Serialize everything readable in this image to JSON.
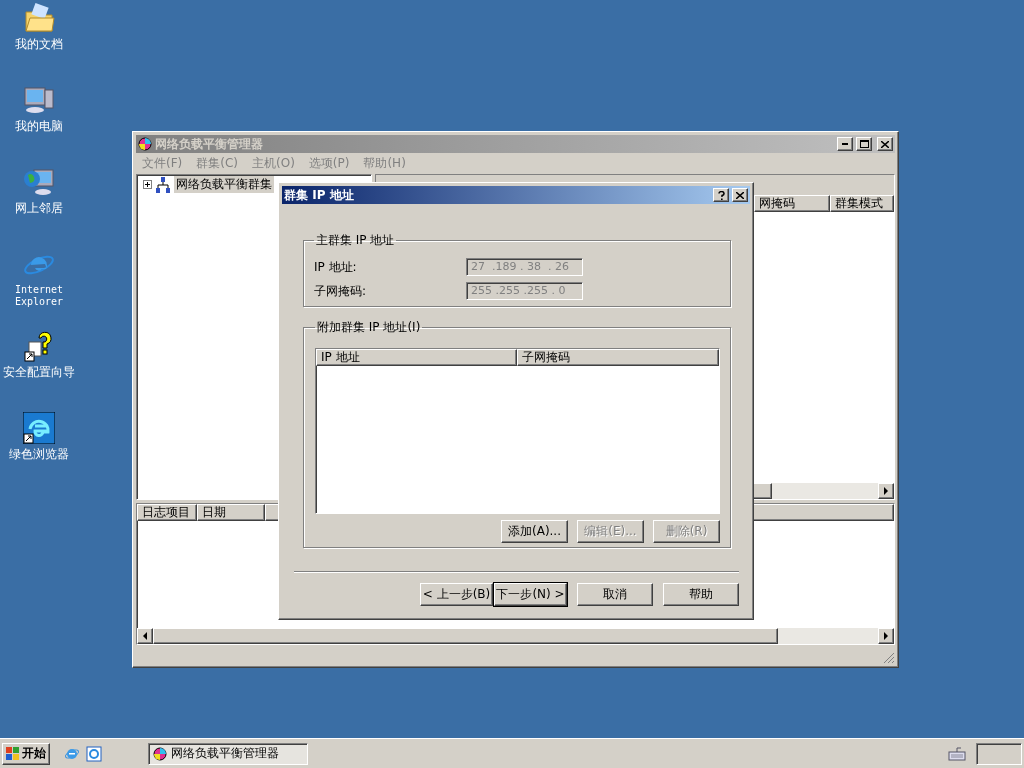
{
  "desktop_icons": [
    {
      "label": "我的文档",
      "kind": "documents"
    },
    {
      "label": "我的电脑",
      "kind": "computer"
    },
    {
      "label": "网上邻居",
      "kind": "network"
    },
    {
      "label": "Internet Explorer",
      "kind": "ie"
    },
    {
      "label": "安全配置向导",
      "kind": "wizard"
    },
    {
      "label": "绿色浏览器",
      "kind": "browser"
    }
  ],
  "main_window": {
    "title": "网络负载平衡管理器",
    "active": false,
    "menu": [
      "文件(F)",
      "群集(C)",
      "主机(O)",
      "选项(P)",
      "帮助(H)"
    ],
    "tree": [
      {
        "label": "网络负载平衡群集",
        "expanded": false
      }
    ],
    "list_columns": [
      "网掩码",
      "群集模式"
    ],
    "log_columns": [
      "日志项目",
      "日期"
    ]
  },
  "dialog": {
    "title": "群集 IP 地址",
    "active": true,
    "primary_group": {
      "legend": "主群集 IP 地址",
      "fields": [
        {
          "label": "IP 地址:",
          "value": "27  .189 . 38  . 26",
          "disabled": true
        },
        {
          "label": "子网掩码:",
          "value": "255 .255 .255 . 0",
          "disabled": true
        }
      ]
    },
    "additional_group": {
      "legend": "附加群集 IP 地址(I)",
      "columns": [
        "IP 地址",
        "子网掩码"
      ],
      "buttons": [
        {
          "label": "添加(A)...",
          "disabled": false
        },
        {
          "label": "编辑(E)...",
          "disabled": true
        },
        {
          "label": "删除(R)",
          "disabled": true
        }
      ]
    },
    "nav_buttons": [
      {
        "label": "< 上一步(B)",
        "default": false
      },
      {
        "label": "下一步(N) >",
        "default": true
      },
      {
        "label": "取消",
        "default": false
      },
      {
        "label": "帮助",
        "default": false
      }
    ]
  },
  "taskbar": {
    "start": "开始",
    "tasks": [
      {
        "label": "网络负载平衡管理器",
        "selected": true
      }
    ]
  }
}
